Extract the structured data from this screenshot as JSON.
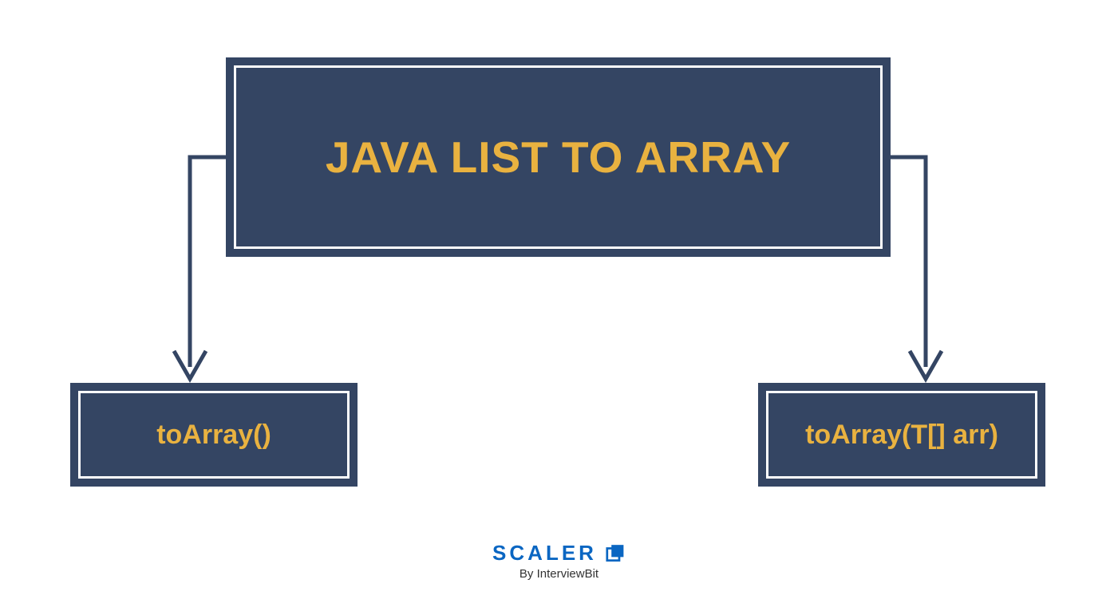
{
  "diagram": {
    "title": "JAVA LIST TO ARRAY",
    "children": {
      "left": "toArray()",
      "right": "toArray(T[] arr)"
    }
  },
  "branding": {
    "name": "SCALER",
    "byline": "By InterviewBit"
  },
  "colors": {
    "box_fill": "#344563",
    "accent_text": "#e9b240",
    "brand": "#0a66c2"
  }
}
